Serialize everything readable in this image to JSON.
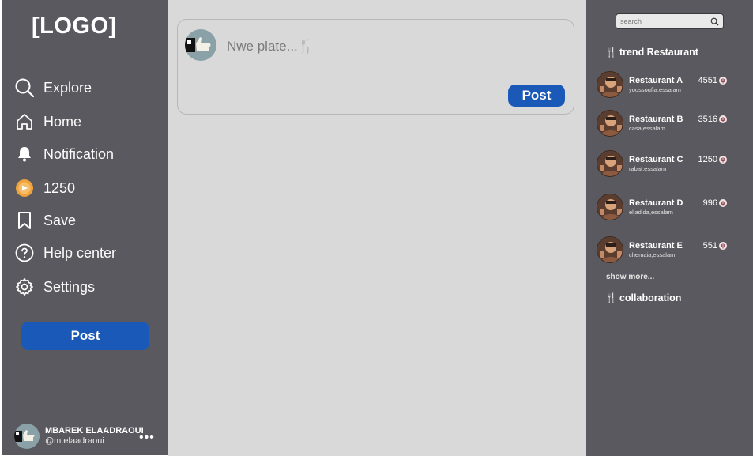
{
  "app": {
    "logo_text": "[LOGO]"
  },
  "left_nav": {
    "items": [
      {
        "label": "Explore",
        "icon": "search-icon"
      },
      {
        "label": "Home",
        "icon": "home-icon"
      },
      {
        "label": "Notification",
        "icon": "bell-icon"
      },
      {
        "label": "1250",
        "icon": "coin-icon"
      },
      {
        "label": "Save",
        "icon": "bookmark-icon"
      },
      {
        "label": "Help center",
        "icon": "help-icon"
      },
      {
        "label": "Settings",
        "icon": "gear-icon"
      }
    ],
    "post_label": "Post"
  },
  "user": {
    "name": "MBAREK ELAADRAOUI",
    "handle": "@m.elaadraoui",
    "more": "•••"
  },
  "composer": {
    "placeholder": "Nwe plate...🍴",
    "post_label": "Post"
  },
  "right_panel": {
    "search_placeholder": "search",
    "trend_title": "trend Restaurant",
    "collab_title": "collaboration",
    "fork_icon": "🍴",
    "show_more": "show more...",
    "restaurants": [
      {
        "name": "Restaurant A",
        "location": "youssoufia,essalam",
        "score": "4551"
      },
      {
        "name": "Restaurant B",
        "location": "casa,essalam",
        "score": "3516"
      },
      {
        "name": "Restaurant C",
        "location": "rabat,essalam",
        "score": "1250"
      },
      {
        "name": "Restaurant D",
        "location": "eljadida,essalam",
        "score": "996"
      },
      {
        "name": "Restaurant E",
        "location": "chemaia,essalam",
        "score": "551"
      }
    ]
  },
  "colors": {
    "sidebar_bg": "#5a595f",
    "center_bg": "#d9d9d9",
    "accent_blue": "#1b59b8",
    "coin_orange": "#f0a33a"
  }
}
